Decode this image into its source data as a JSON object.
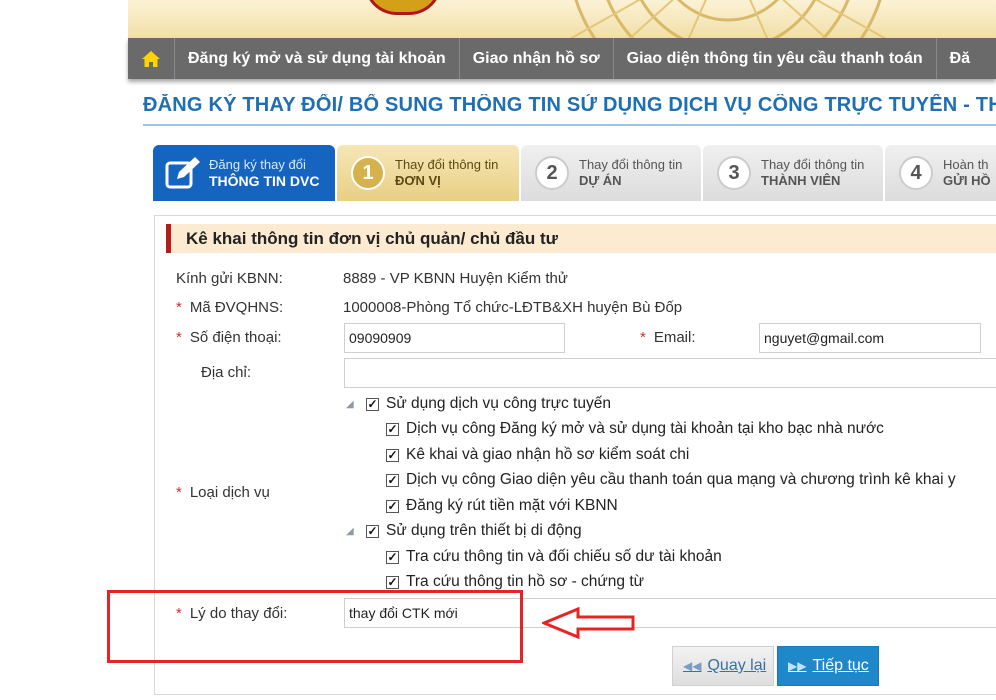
{
  "nav": {
    "home_icon": "home-icon",
    "items": [
      {
        "label": "Đăng ký mở và sử dụng tài khoản"
      },
      {
        "label": "Giao nhận hồ sơ"
      },
      {
        "label": "Giao diện thông tin yêu cầu thanh toán"
      },
      {
        "label": "Đă"
      }
    ]
  },
  "page": {
    "title": "ĐĂNG KÝ THAY ĐỔI/ BỔ SUNG THÔNG TIN SỬ DỤNG DỊCH VỤ CÔNG TRỰC TUYẾN - THÔ"
  },
  "steps": [
    {
      "line1": "Đăng ký thay đổi",
      "line2": "THÔNG TIN DVC",
      "icon": "edit-icon"
    },
    {
      "num": "1",
      "line1": "Thay đổi thông tin",
      "line2": "ĐƠN VỊ"
    },
    {
      "num": "2",
      "line1": "Thay đổi thông tin",
      "line2": "DỰ ÁN"
    },
    {
      "num": "3",
      "line1": "Thay đổi thông tin",
      "line2": "THÀNH VIÊN"
    },
    {
      "num": "4",
      "line1": "Hoàn th",
      "line2": "GỬI HỒ"
    }
  ],
  "section": {
    "title": "Kê khai thông tin đơn vị chủ quản/ chủ đầu tư"
  },
  "form": {
    "required_mark": "*",
    "kbnn_label": "Kính gửi KBNN:",
    "kbnn_value": "8889  - VP KBNN Huyện Kiểm thử",
    "dvqhns_label": "Mã ĐVQHNS:",
    "dvqhns_value": "1000008-Phòng Tổ chức-LĐTB&XH huyện Bù Đốp",
    "phone_label": "Số điện thoại:",
    "phone_value": "09090909",
    "email_label": "Email:",
    "email_value": "nguyet@gmail.com",
    "address_label": "Địa chỉ:",
    "address_value": "",
    "service_label": "Loại dịch vụ",
    "reason_label": "Lý do thay đổi:",
    "reason_value": "thay đổi CTK mới"
  },
  "services": {
    "group1": {
      "label": "Sử dụng dịch vụ công trực tuyến",
      "checked": true,
      "children": [
        {
          "label": "Dịch vụ công Đăng ký mở và sử dụng tài khoản tại kho bạc nhà nước",
          "checked": true
        },
        {
          "label": "Kê khai và giao nhận hồ sơ kiểm soát chi",
          "checked": true
        },
        {
          "label": "Dịch vụ công Giao diện yêu cầu thanh toán qua mạng và chương trình kê khai y",
          "checked": true
        },
        {
          "label": "Đăng ký rút tiền mặt với KBNN",
          "checked": true
        }
      ]
    },
    "group2": {
      "label": "Sử dụng trên thiết bị di động",
      "checked": true,
      "children": [
        {
          "label": "Tra cứu thông tin và đối chiếu số dư tài khoản",
          "checked": true
        },
        {
          "label": "Tra cứu thông tin hồ sơ - chứng từ",
          "checked": true
        }
      ]
    }
  },
  "buttons": {
    "back": "Quay lại",
    "next": "Tiếp tục"
  },
  "colors": {
    "accent": "#1f6fb3",
    "annotation": "#e82323",
    "navbar": "#6a6a6a"
  }
}
